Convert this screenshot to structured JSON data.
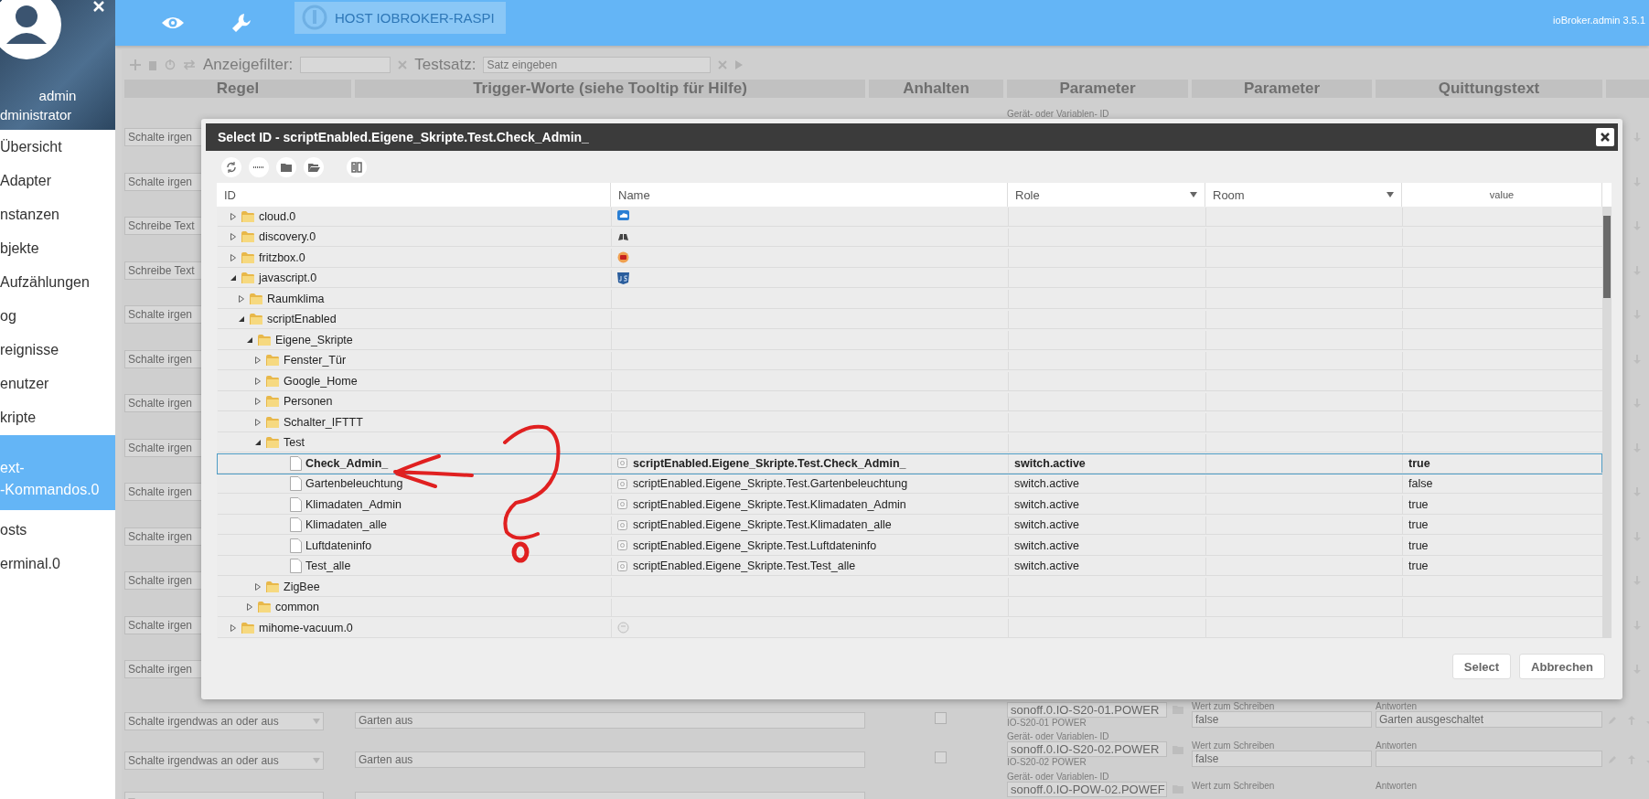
{
  "header": {
    "host_button": "HOST IOBROKER-RASPI",
    "version": "ioBroker.admin 3.5.1"
  },
  "sidebar": {
    "user": "admin",
    "role": "dministrator",
    "items": [
      {
        "label": "Übersicht",
        "selected": false
      },
      {
        "label": "Adapter",
        "selected": false
      },
      {
        "label": "nstanzen",
        "selected": false
      },
      {
        "label": "bjekte",
        "selected": false
      },
      {
        "label": "Aufzählungen",
        "selected": false
      },
      {
        "label": "og",
        "selected": false
      },
      {
        "label": "reignisse",
        "selected": false
      },
      {
        "label": "enutzer",
        "selected": false
      },
      {
        "label": "kripte",
        "selected": false
      },
      {
        "label": "ext-\n-Kommandos.0",
        "selected": true
      },
      {
        "label": "osts",
        "selected": false
      },
      {
        "label": "erminal.0",
        "selected": false
      }
    ]
  },
  "background": {
    "toolbar": {
      "filter_label": "Anzeigefilter:",
      "test_label": "Testsatz:",
      "test_placeholder": "Satz eingeben"
    },
    "columns": [
      "Regel",
      "Trigger-Worte (siehe Tooltip für Hilfe)",
      "Anhalten",
      "Parameter",
      "Parameter",
      "Quittungstext"
    ],
    "rows": [
      {
        "kind": "partial",
        "rule": "Schalte irgen",
        "param_label": "Gerät- oder Variablen- ID"
      },
      {
        "kind": "partial",
        "rule": "Schalte irgen"
      },
      {
        "kind": "partial",
        "rule": "Schreibe Text"
      },
      {
        "kind": "partial",
        "rule": "Schreibe Text"
      },
      {
        "kind": "partial",
        "rule": "Schalte irgen"
      },
      {
        "kind": "partial",
        "rule": "Schalte irgen"
      },
      {
        "kind": "partial",
        "rule": "Schalte irgen"
      },
      {
        "kind": "partial",
        "rule": "Schalte irgen"
      },
      {
        "kind": "partial",
        "rule": "Schalte irgen"
      },
      {
        "kind": "partial",
        "rule": "Schalte irgen"
      },
      {
        "kind": "partial",
        "rule": "Schalte irgen"
      },
      {
        "kind": "partial",
        "rule": "Schalte irgen"
      },
      {
        "kind": "partial",
        "rule": "Schalte irgen"
      },
      {
        "kind": "full",
        "rule": "Schalte irgendwas an oder aus",
        "trigger": "Garten aus",
        "checked": false,
        "param_id": "sonoff.0.IO-S20-01.POWER",
        "param_name": "IO-S20-01 POWER",
        "value_label": "Wert zum Schreiben",
        "value": "false",
        "answer_label": "Antworten",
        "answer": "Garten ausgeschaltet"
      },
      {
        "kind": "full",
        "rule": "Schalte irgendwas an oder aus",
        "trigger": "Garten aus",
        "checked": false,
        "param_label": "Gerät- oder Variablen- ID",
        "param_id": "sonoff.0.IO-S20-02.POWER",
        "param_name": "IO-S20-02 POWER",
        "value_label": "Wert zum Schreiben",
        "value": "false",
        "answer_label": "Antworten"
      },
      {
        "kind": "full",
        "param_label": "Gerät- oder Variablen- ID",
        "param_id": "sonoff.0.IO-POW-02.POWEF",
        "value_label": "Wert zum Schreiben",
        "answer_label": "Antworten"
      }
    ]
  },
  "dialog": {
    "title": "Select ID - scriptEnabled.Eigene_Skripte.Test.Check_Admin_",
    "columns": [
      {
        "label": "ID",
        "kind": "plain"
      },
      {
        "label": "Name",
        "kind": "plain"
      },
      {
        "label": "Role",
        "kind": "filter"
      },
      {
        "label": "Room",
        "kind": "filter"
      },
      {
        "label": "value",
        "kind": "small"
      }
    ],
    "tree": [
      {
        "id": "cloud.0",
        "kind": "folder",
        "expanded": false,
        "selected": false
      },
      {
        "id": "discovery.0",
        "kind": "folder",
        "expanded": false,
        "selected": false
      },
      {
        "id": "fritzbox.0",
        "kind": "folder",
        "expanded": false,
        "selected": false
      },
      {
        "id": "javascript.0",
        "kind": "folder",
        "expanded": true,
        "selected": false,
        "children": [
          {
            "id": "Raumklima",
            "kind": "folder",
            "expanded": false,
            "selected": false
          },
          {
            "id": "scriptEnabled",
            "kind": "folder",
            "expanded": true,
            "selected": false,
            "children": [
              {
                "id": "Eigene_Skripte",
                "kind": "folder",
                "expanded": true,
                "selected": false,
                "children": [
                  {
                    "id": "Fenster_Tür",
                    "kind": "folder",
                    "expanded": false,
                    "selected": false
                  },
                  {
                    "id": "Google_Home",
                    "kind": "folder",
                    "expanded": false,
                    "selected": false
                  },
                  {
                    "id": "Personen",
                    "kind": "folder",
                    "expanded": false,
                    "selected": false
                  },
                  {
                    "id": "Schalter_IFTTT",
                    "kind": "folder",
                    "expanded": false,
                    "selected": false
                  },
                  {
                    "id": "Test",
                    "kind": "folder",
                    "expanded": true,
                    "selected": false,
                    "children": [
                      {
                        "id": "Check_Admin_",
                        "kind": "state",
                        "selected": true,
                        "name": "scriptEnabled.Eigene_Skripte.Test.Check_Admin_",
                        "role": "switch.active",
                        "value": "true"
                      },
                      {
                        "id": "Gartenbeleuchtung",
                        "kind": "state",
                        "selected": false,
                        "name": "scriptEnabled.Eigene_Skripte.Test.Gartenbeleuchtung",
                        "role": "switch.active",
                        "value": "false"
                      },
                      {
                        "id": "Klimadaten_Admin",
                        "kind": "state",
                        "selected": false,
                        "name": "scriptEnabled.Eigene_Skripte.Test.Klimadaten_Admin",
                        "role": "switch.active",
                        "value": "true"
                      },
                      {
                        "id": "Klimadaten_alle",
                        "kind": "state",
                        "selected": false,
                        "name": "scriptEnabled.Eigene_Skripte.Test.Klimadaten_alle",
                        "role": "switch.active",
                        "value": "true"
                      },
                      {
                        "id": "Luftdateninfo",
                        "kind": "state",
                        "selected": false,
                        "name": "scriptEnabled.Eigene_Skripte.Test.Luftdateninfo",
                        "role": "switch.active",
                        "value": "true"
                      },
                      {
                        "id": "Test_alle",
                        "kind": "state",
                        "selected": false,
                        "name": "scriptEnabled.Eigene_Skripte.Test.Test_alle",
                        "role": "switch.active",
                        "value": "true"
                      }
                    ]
                  },
                  {
                    "id": "ZigBee",
                    "kind": "folder",
                    "expanded": false,
                    "selected": false
                  }
                ]
              },
              {
                "id": "common",
                "kind": "folder",
                "expanded": false,
                "selected": false
              }
            ]
          }
        ]
      },
      {
        "id": "mihome-vacuum.0",
        "kind": "folder",
        "expanded": false,
        "selected": false
      }
    ],
    "buttons": [
      "Select",
      "Abbrechen"
    ]
  }
}
